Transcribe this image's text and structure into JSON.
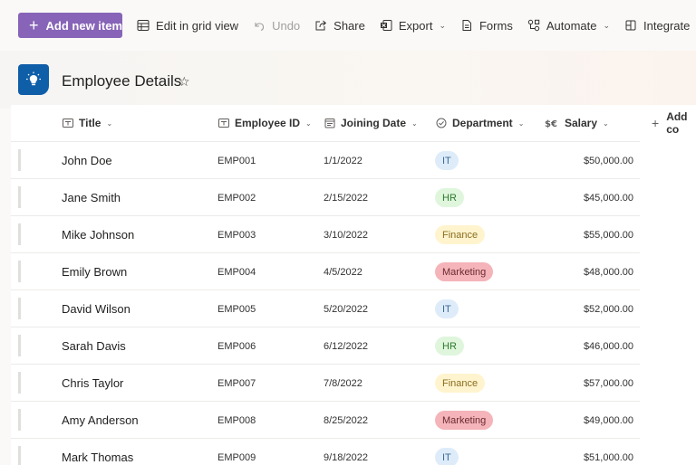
{
  "toolbar": {
    "add_new_item": "Add new item",
    "edit_grid": "Edit in grid view",
    "undo": "Undo",
    "share": "Share",
    "export": "Export",
    "forms": "Forms",
    "automate": "Automate",
    "integrate": "Integrate"
  },
  "list": {
    "title": "Employee Details"
  },
  "columns": {
    "title": "Title",
    "employee_id": "Employee ID",
    "joining_date": "Joining Date",
    "department": "Department",
    "salary": "Salary",
    "add_column": "Add co"
  },
  "department_colors": {
    "IT": {
      "bg": "#deecf9",
      "fg": "#3a6a99"
    },
    "HR": {
      "bg": "#dff6dd",
      "fg": "#2f7a2f"
    },
    "Finance": {
      "bg": "#fff4ce",
      "fg": "#8a6d1f"
    },
    "Marketing": {
      "bg": "#f4b4b9",
      "fg": "#6b2a30"
    }
  },
  "rows": [
    {
      "title": "John Doe",
      "employee_id": "EMP001",
      "joining_date": "1/1/2022",
      "department": "IT",
      "salary": "$50,000.00"
    },
    {
      "title": "Jane Smith",
      "employee_id": "EMP002",
      "joining_date": "2/15/2022",
      "department": "HR",
      "salary": "$45,000.00"
    },
    {
      "title": "Mike Johnson",
      "employee_id": "EMP003",
      "joining_date": "3/10/2022",
      "department": "Finance",
      "salary": "$55,000.00"
    },
    {
      "title": "Emily Brown",
      "employee_id": "EMP004",
      "joining_date": "4/5/2022",
      "department": "Marketing",
      "salary": "$48,000.00"
    },
    {
      "title": "David Wilson",
      "employee_id": "EMP005",
      "joining_date": "5/20/2022",
      "department": "IT",
      "salary": "$52,000.00"
    },
    {
      "title": "Sarah Davis",
      "employee_id": "EMP006",
      "joining_date": "6/12/2022",
      "department": "HR",
      "salary": "$46,000.00"
    },
    {
      "title": "Chris Taylor",
      "employee_id": "EMP007",
      "joining_date": "7/8/2022",
      "department": "Finance",
      "salary": "$57,000.00"
    },
    {
      "title": "Amy Anderson",
      "employee_id": "EMP008",
      "joining_date": "8/25/2022",
      "department": "Marketing",
      "salary": "$49,000.00"
    },
    {
      "title": "Mark Thomas",
      "employee_id": "EMP009",
      "joining_date": "9/18/2022",
      "department": "IT",
      "salary": "$51,000.00"
    }
  ]
}
